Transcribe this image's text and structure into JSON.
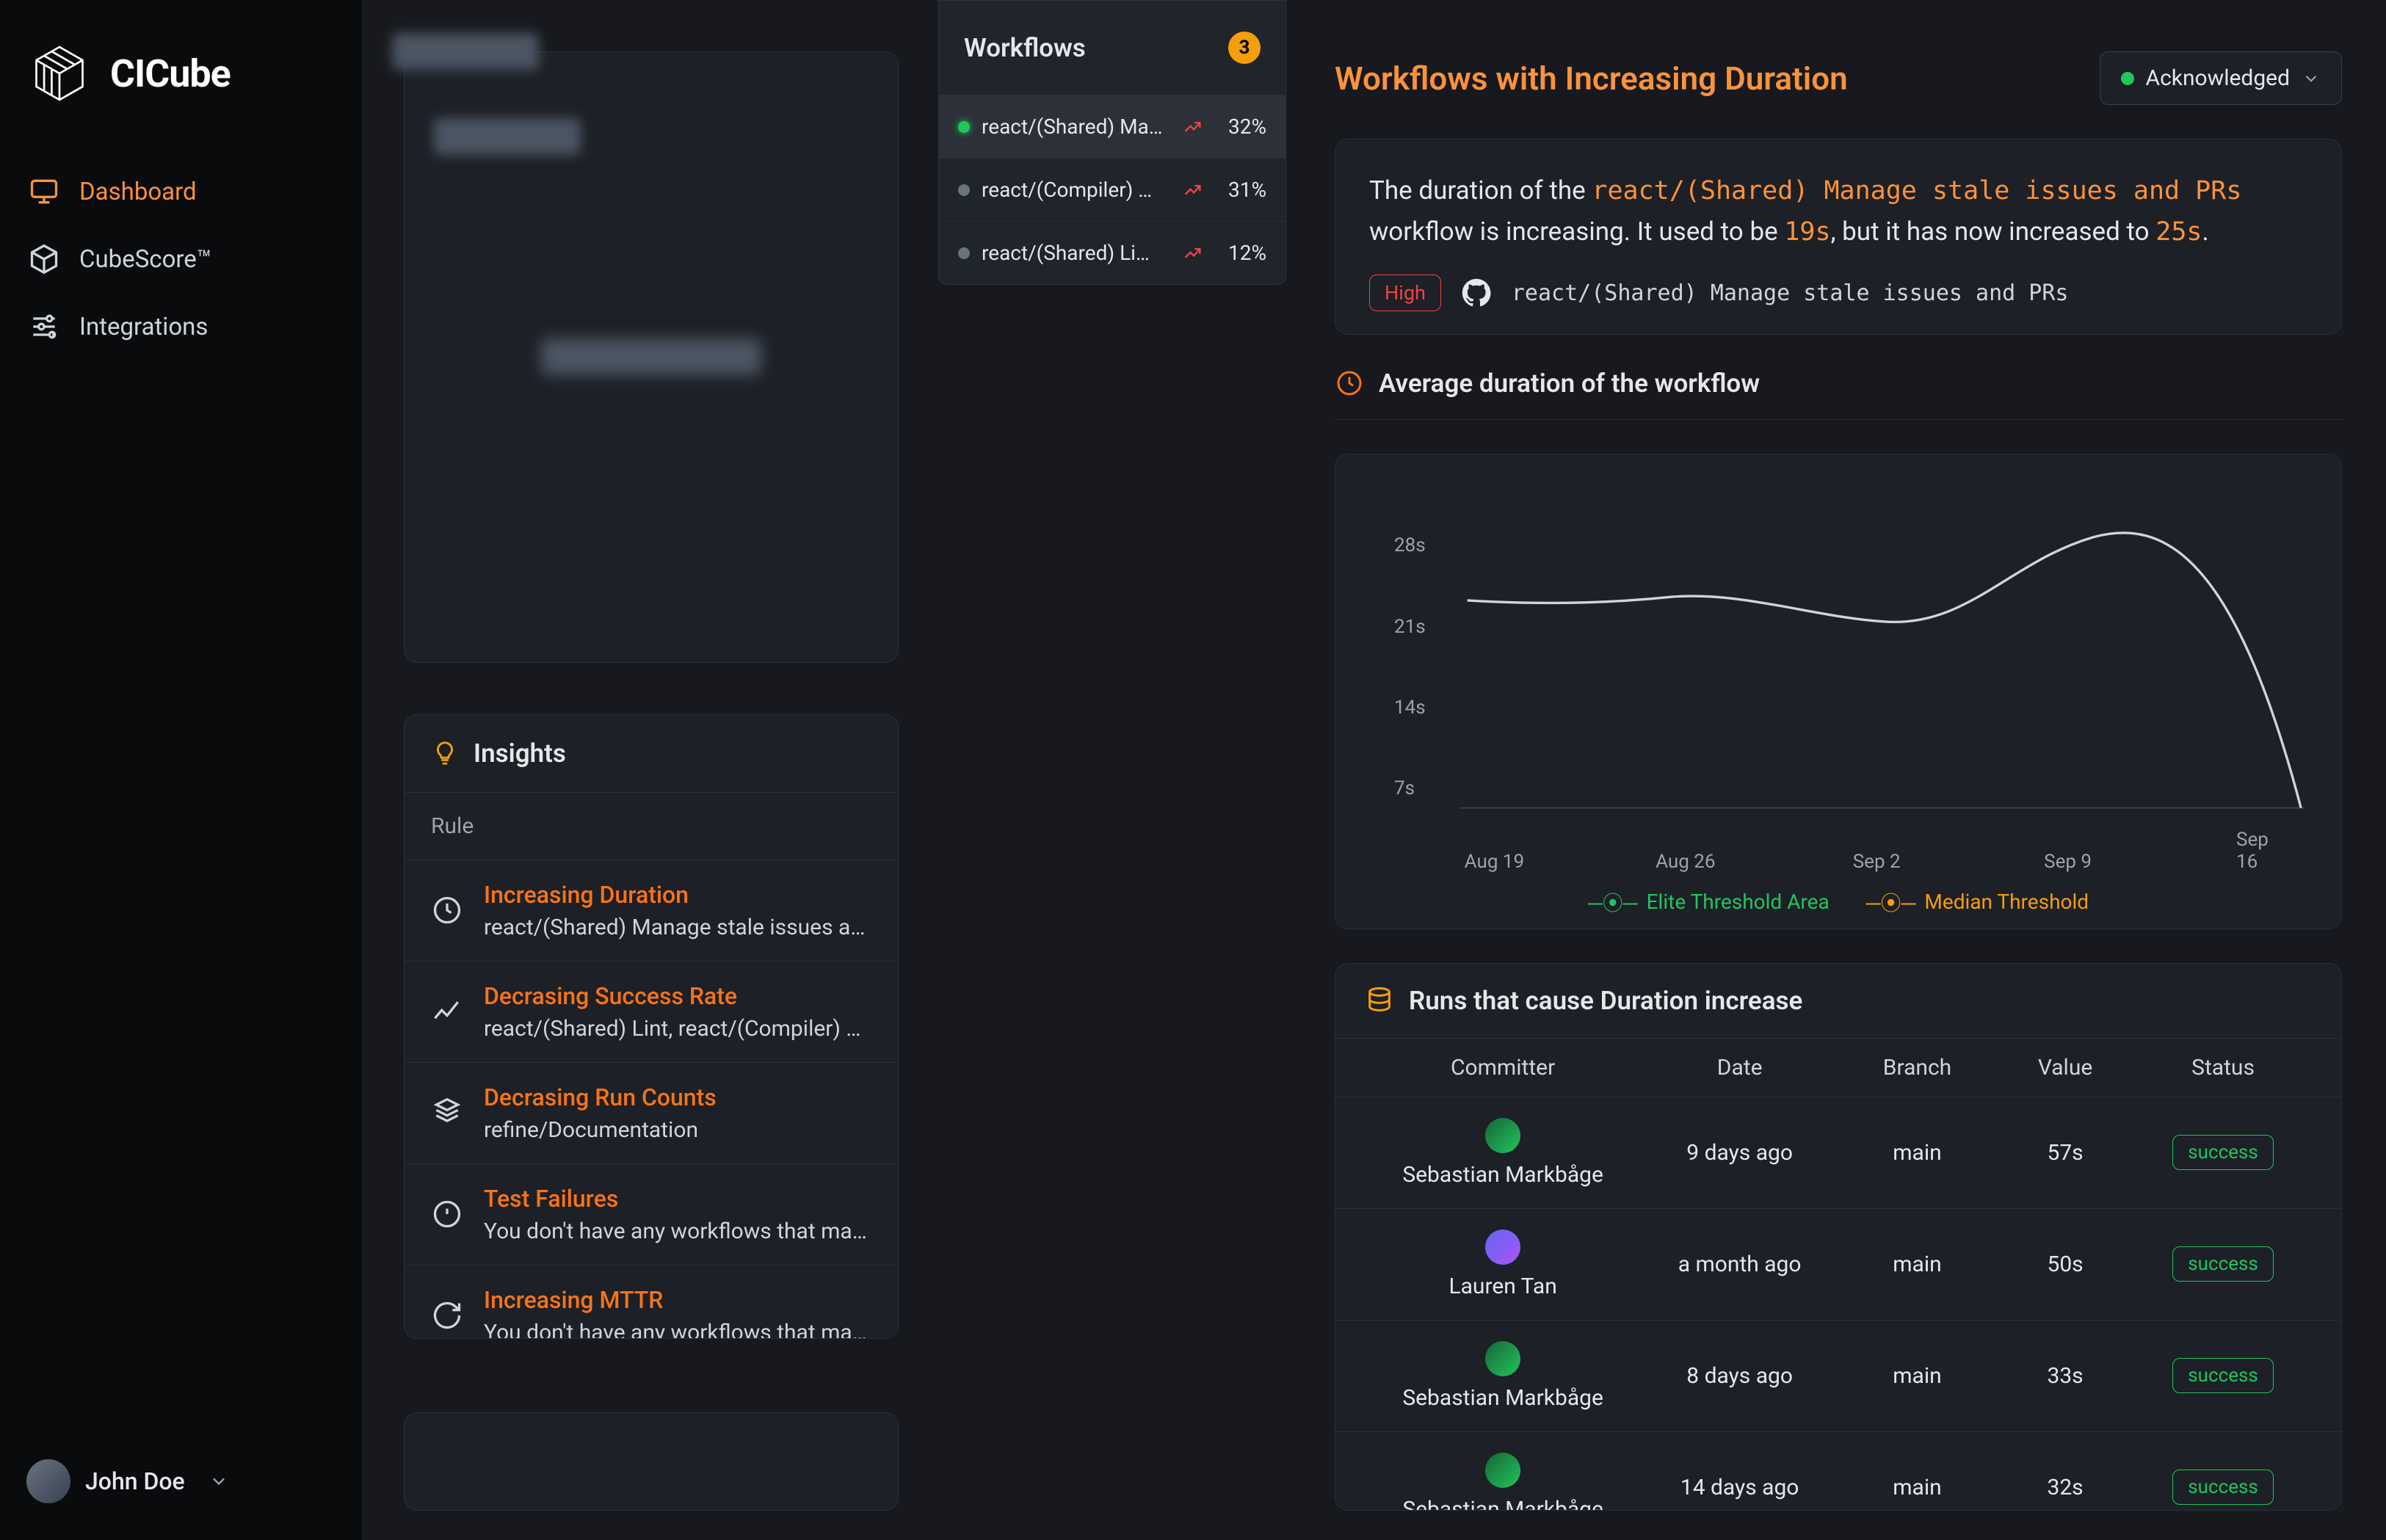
{
  "brand": "CICube",
  "nav": {
    "dashboard": "Dashboard",
    "cubescore": "CubeScore™",
    "integrations": "Integrations"
  },
  "user": {
    "name": "John Doe"
  },
  "insights": {
    "title": "Insights",
    "rule_label": "Rule",
    "items": [
      {
        "title": "Increasing Duration",
        "sub": "react/(Shared) Manage stale issues and PRs, react/(C"
      },
      {
        "title": "Decrasing Success Rate",
        "sub": "react/(Shared) Lint, react/(Compiler) Playground"
      },
      {
        "title": "Decrasing Run Counts",
        "sub": "refine/Documentation"
      },
      {
        "title": "Test Failures",
        "sub": "You don't have any workflows that match this rule"
      },
      {
        "title": "Increasing MTTR",
        "sub": "You don't have any workflows that match this rule"
      }
    ]
  },
  "workflows": {
    "title": "Workflows",
    "count": "3",
    "items": [
      {
        "name": "react/(Shared) Ma…",
        "pct": "32%",
        "active": true,
        "dot": "green"
      },
      {
        "name": "react/(Compiler) …",
        "pct": "31%",
        "active": false,
        "dot": "gray"
      },
      {
        "name": "react/(Shared) Li…",
        "pct": "12%",
        "active": false,
        "dot": "gray"
      }
    ]
  },
  "detail": {
    "title": "Workflows with Increasing Duration",
    "ack": "Acknowledged",
    "summary_pre": "The duration of the ",
    "summary_workflow": "react/(Shared) Manage stale issues and PRs",
    "summary_mid1": " workflow is increasing. It used to be ",
    "summary_old": "19s",
    "summary_mid2": ", but it has now increased to ",
    "summary_new": "25s",
    "summary_post": ".",
    "tag": "High",
    "repo": "react/(Shared) Manage stale issues and PRs",
    "avg_title": "Average duration of the workflow",
    "legend_elite": "Elite Threshold Area",
    "legend_median": "Median Threshold",
    "runs_title": "Runs that cause Duration increase",
    "cols": {
      "committer": "Committer",
      "date": "Date",
      "branch": "Branch",
      "value": "Value",
      "status": "Status"
    },
    "rows": [
      {
        "committer": "Sebastian Markbåge",
        "date": "9 days ago",
        "branch": "main",
        "value": "57s",
        "status": "success",
        "av": "green"
      },
      {
        "committer": "Lauren Tan",
        "date": "a month ago",
        "branch": "main",
        "value": "50s",
        "status": "success",
        "av": "purple"
      },
      {
        "committer": "Sebastian Markbåge",
        "date": "8 days ago",
        "branch": "main",
        "value": "33s",
        "status": "success",
        "av": "green"
      },
      {
        "committer": "Sebastian Markbåge",
        "date": "14 days ago",
        "branch": "main",
        "value": "32s",
        "status": "success",
        "av": "green"
      }
    ]
  },
  "chart_data": {
    "type": "line",
    "x_labels": [
      "Aug 19",
      "Aug 26",
      "Sep 2",
      "Sep 9",
      "Sep 16"
    ],
    "y_ticks": [
      "7s",
      "14s",
      "21s",
      "28s"
    ],
    "ylim": [
      0,
      28
    ],
    "series": [
      {
        "name": "duration",
        "x": [
          "Aug 19",
          "Aug 23",
          "Aug 26",
          "Aug 30",
          "Sep 2",
          "Sep 5",
          "Sep 9",
          "Sep 12",
          "Sep 16"
        ],
        "y": [
          20,
          19.5,
          20,
          19,
          18,
          22,
          26,
          24,
          1
        ]
      }
    ],
    "title": "Average duration of the workflow",
    "xlabel": "",
    "ylabel": ""
  }
}
